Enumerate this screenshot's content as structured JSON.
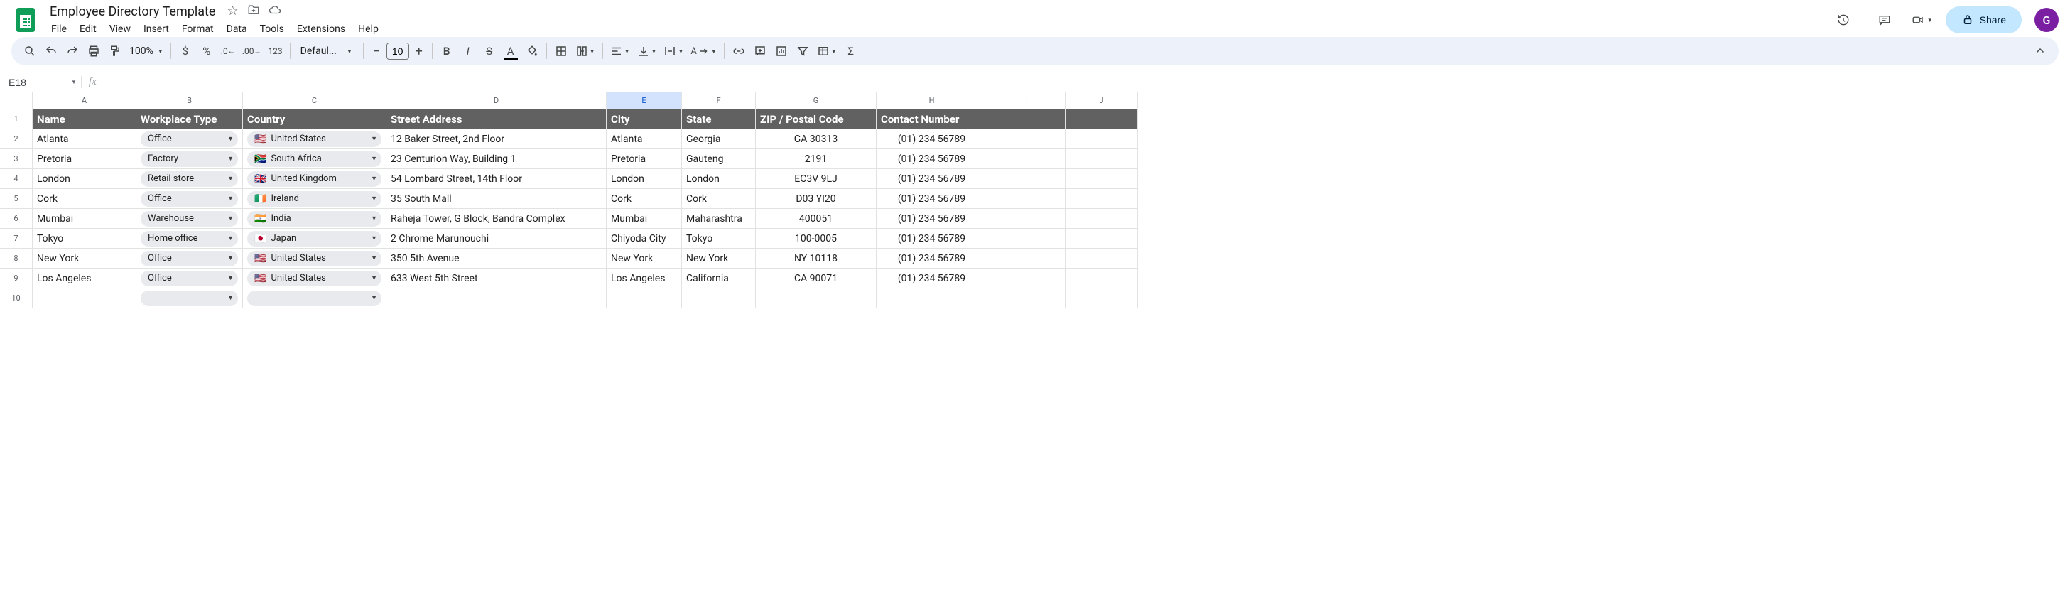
{
  "doc": {
    "title": "Employee Directory Template"
  },
  "menus": [
    "File",
    "Edit",
    "View",
    "Insert",
    "Format",
    "Data",
    "Tools",
    "Extensions",
    "Help"
  ],
  "toolbar": {
    "zoom": "100%",
    "font": "Defaul...",
    "font_size": "10"
  },
  "share_label": "Share",
  "avatar_letter": "G",
  "name_box": "E18",
  "formula": "",
  "columns": [
    "A",
    "B",
    "C",
    "D",
    "E",
    "F",
    "G",
    "H",
    "I",
    "J"
  ],
  "selected_col": "E",
  "headers": [
    "Name",
    "Workplace Type",
    "Country",
    "Street Address",
    "City",
    "State",
    "ZIP / Postal Code",
    "Contact Number"
  ],
  "rows": [
    {
      "name": "Atlanta",
      "type": "Office",
      "country": "United States",
      "flag": "🇺🇸",
      "addr": "12 Baker Street, 2nd Floor",
      "city": "Atlanta",
      "state": "Georgia",
      "zip": "GA 30313",
      "contact": "(01) 234 56789"
    },
    {
      "name": "Pretoria",
      "type": "Factory",
      "country": "South Africa",
      "flag": "🇿🇦",
      "addr": "23 Centurion Way, Building 1",
      "city": "Pretoria",
      "state": "Gauteng",
      "zip": "2191",
      "contact": "(01) 234 56789"
    },
    {
      "name": "London",
      "type": "Retail store",
      "country": "United Kingdom",
      "flag": "🇬🇧",
      "addr": "54 Lombard Street, 14th Floor",
      "city": "London",
      "state": "London",
      "zip": "EC3V 9LJ",
      "contact": "(01) 234 56789"
    },
    {
      "name": "Cork",
      "type": "Office",
      "country": "Ireland",
      "flag": "🇮🇪",
      "addr": "35 South Mall",
      "city": "Cork",
      "state": "Cork",
      "zip": "D03 YI20",
      "contact": "(01) 234 56789"
    },
    {
      "name": "Mumbai",
      "type": "Warehouse",
      "country": "India",
      "flag": "🇮🇳",
      "addr": "Raheja Tower, G Block, Bandra Complex",
      "city": "Mumbai",
      "state": "Maharashtra",
      "zip": "400051",
      "contact": "(01) 234 56789"
    },
    {
      "name": "Tokyo",
      "type": "Home office",
      "country": "Japan",
      "flag": "🇯🇵",
      "addr": "2 Chrome Marunouchi",
      "city": "Chiyoda City",
      "state": "Tokyo",
      "zip": "100-0005",
      "contact": "(01) 234 56789"
    },
    {
      "name": "New York",
      "type": "Office",
      "country": "United States",
      "flag": "🇺🇸",
      "addr": "350 5th Avenue",
      "city": "New York",
      "state": "New York",
      "zip": "NY 10118",
      "contact": "(01) 234 56789"
    },
    {
      "name": "Los Angeles",
      "type": "Office",
      "country": "United States",
      "flag": "🇺🇸",
      "addr": "633 West 5th Street",
      "city": "Los Angeles",
      "state": "California",
      "zip": "CA 90071",
      "contact": "(01) 234 56789"
    }
  ],
  "empty_rows": 1
}
